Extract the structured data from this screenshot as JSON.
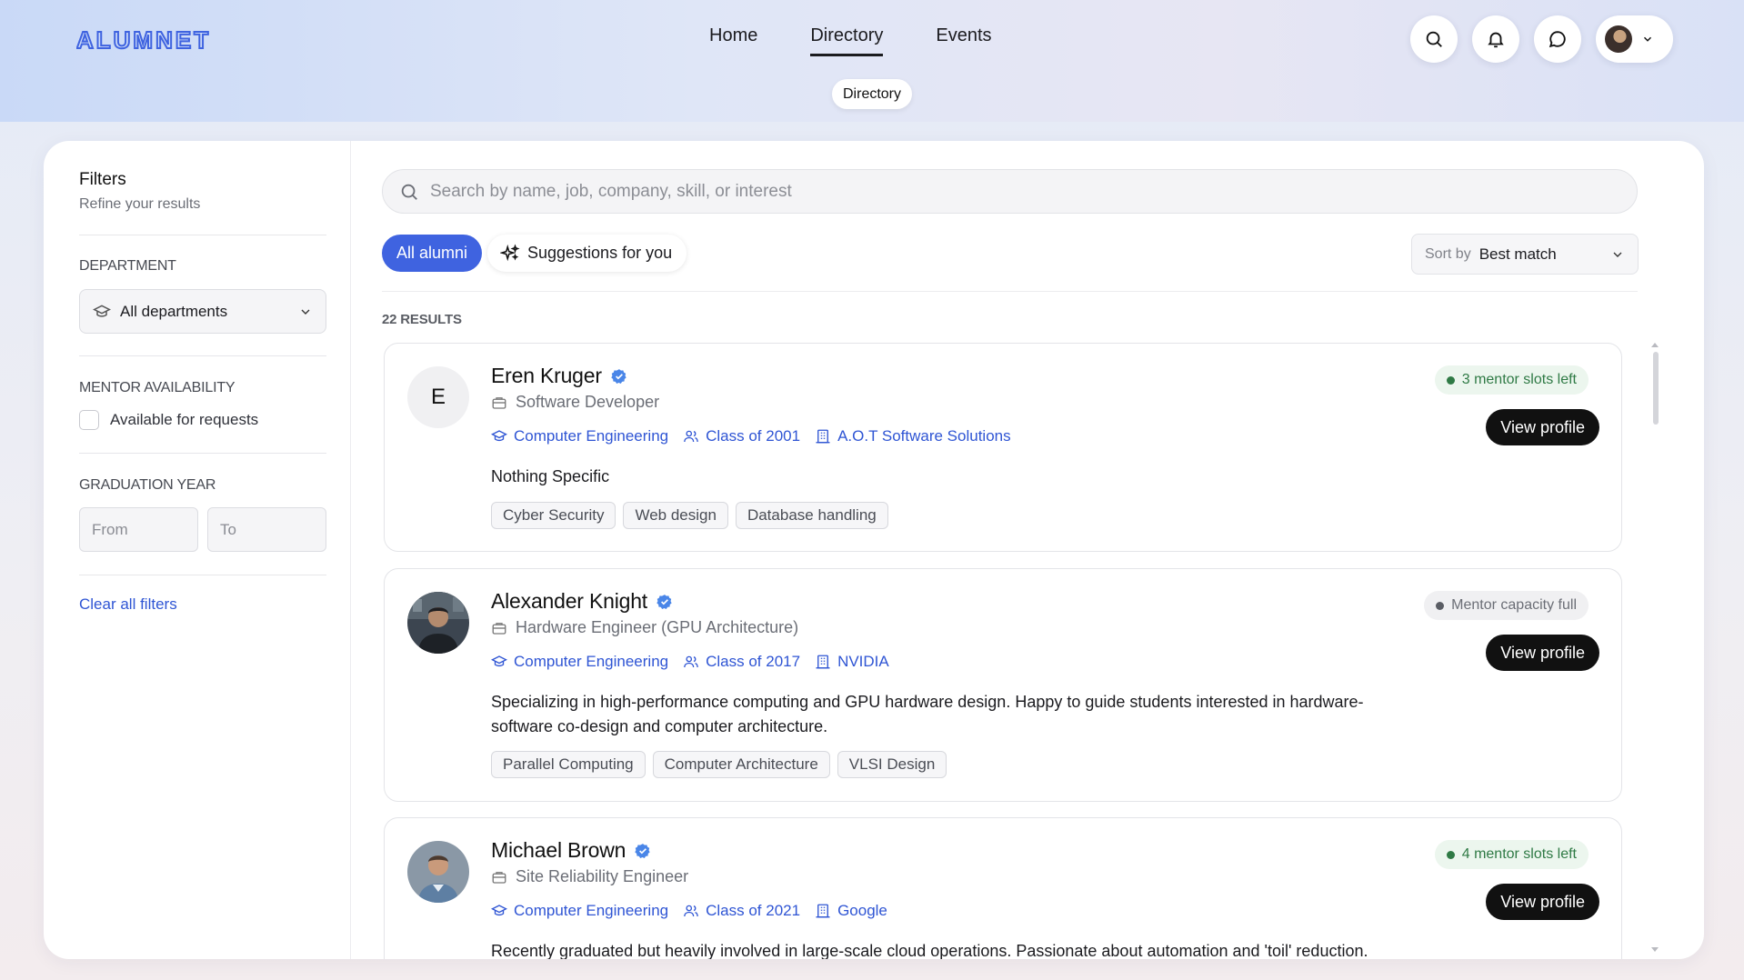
{
  "brand": {
    "logo_text": "ALUMNET"
  },
  "nav": {
    "items": [
      {
        "label": "Home"
      },
      {
        "label": "Directory"
      },
      {
        "label": "Events"
      }
    ],
    "tooltip": "Directory"
  },
  "filters": {
    "title": "Filters",
    "subtitle": "Refine your results",
    "department": {
      "label": "DEPARTMENT",
      "value": "All departments"
    },
    "mentor": {
      "label": "MENTOR AVAILABILITY",
      "checkbox_label": "Available for requests"
    },
    "graduation": {
      "label": "GRADUATION YEAR",
      "from_placeholder": "From",
      "to_placeholder": "To"
    },
    "clear_label": "Clear all filters"
  },
  "search": {
    "placeholder": "Search by name, job, company, skill, or interest"
  },
  "tabs": {
    "all": "All alumni",
    "suggestions": "Suggestions for you"
  },
  "sort": {
    "label": "Sort by",
    "value": "Best match"
  },
  "results_count": "22 RESULTS",
  "colors": {
    "accent": "#3f63e0",
    "link": "#2f55d4",
    "success": "#2f7a45",
    "button": "#111111"
  },
  "alumni": [
    {
      "initial": "E",
      "name": "Eren Kruger",
      "role": "Software Developer",
      "department": "Computer Engineering",
      "class_of": "Class of 2001",
      "company": "A.O.T Software Solutions",
      "bio": "Nothing Specific",
      "tags": [
        "Cyber Security",
        "Web design",
        "Database handling"
      ],
      "status": "3 mentor slots left",
      "button": "View profile"
    },
    {
      "name": "Alexander Knight",
      "role": "Hardware Engineer (GPU Architecture)",
      "department": "Computer Engineering",
      "class_of": "Class of 2017",
      "company": "NVIDIA",
      "bio": "Specializing in high-performance computing and GPU hardware design. Happy to guide students interested in hardware-software co-design and computer architecture.",
      "tags": [
        "Parallel Computing",
        "Computer Architecture",
        "VLSI Design"
      ],
      "status": "Mentor capacity full",
      "button": "View profile"
    },
    {
      "name": "Michael Brown",
      "role": "Site Reliability Engineer",
      "department": "Computer Engineering",
      "class_of": "Class of 2021",
      "company": "Google",
      "bio": "Recently graduated but heavily involved in large-scale cloud operations. Passionate about automation and 'toil' reduction.",
      "status": "4 mentor slots left",
      "button": "View profile"
    }
  ]
}
